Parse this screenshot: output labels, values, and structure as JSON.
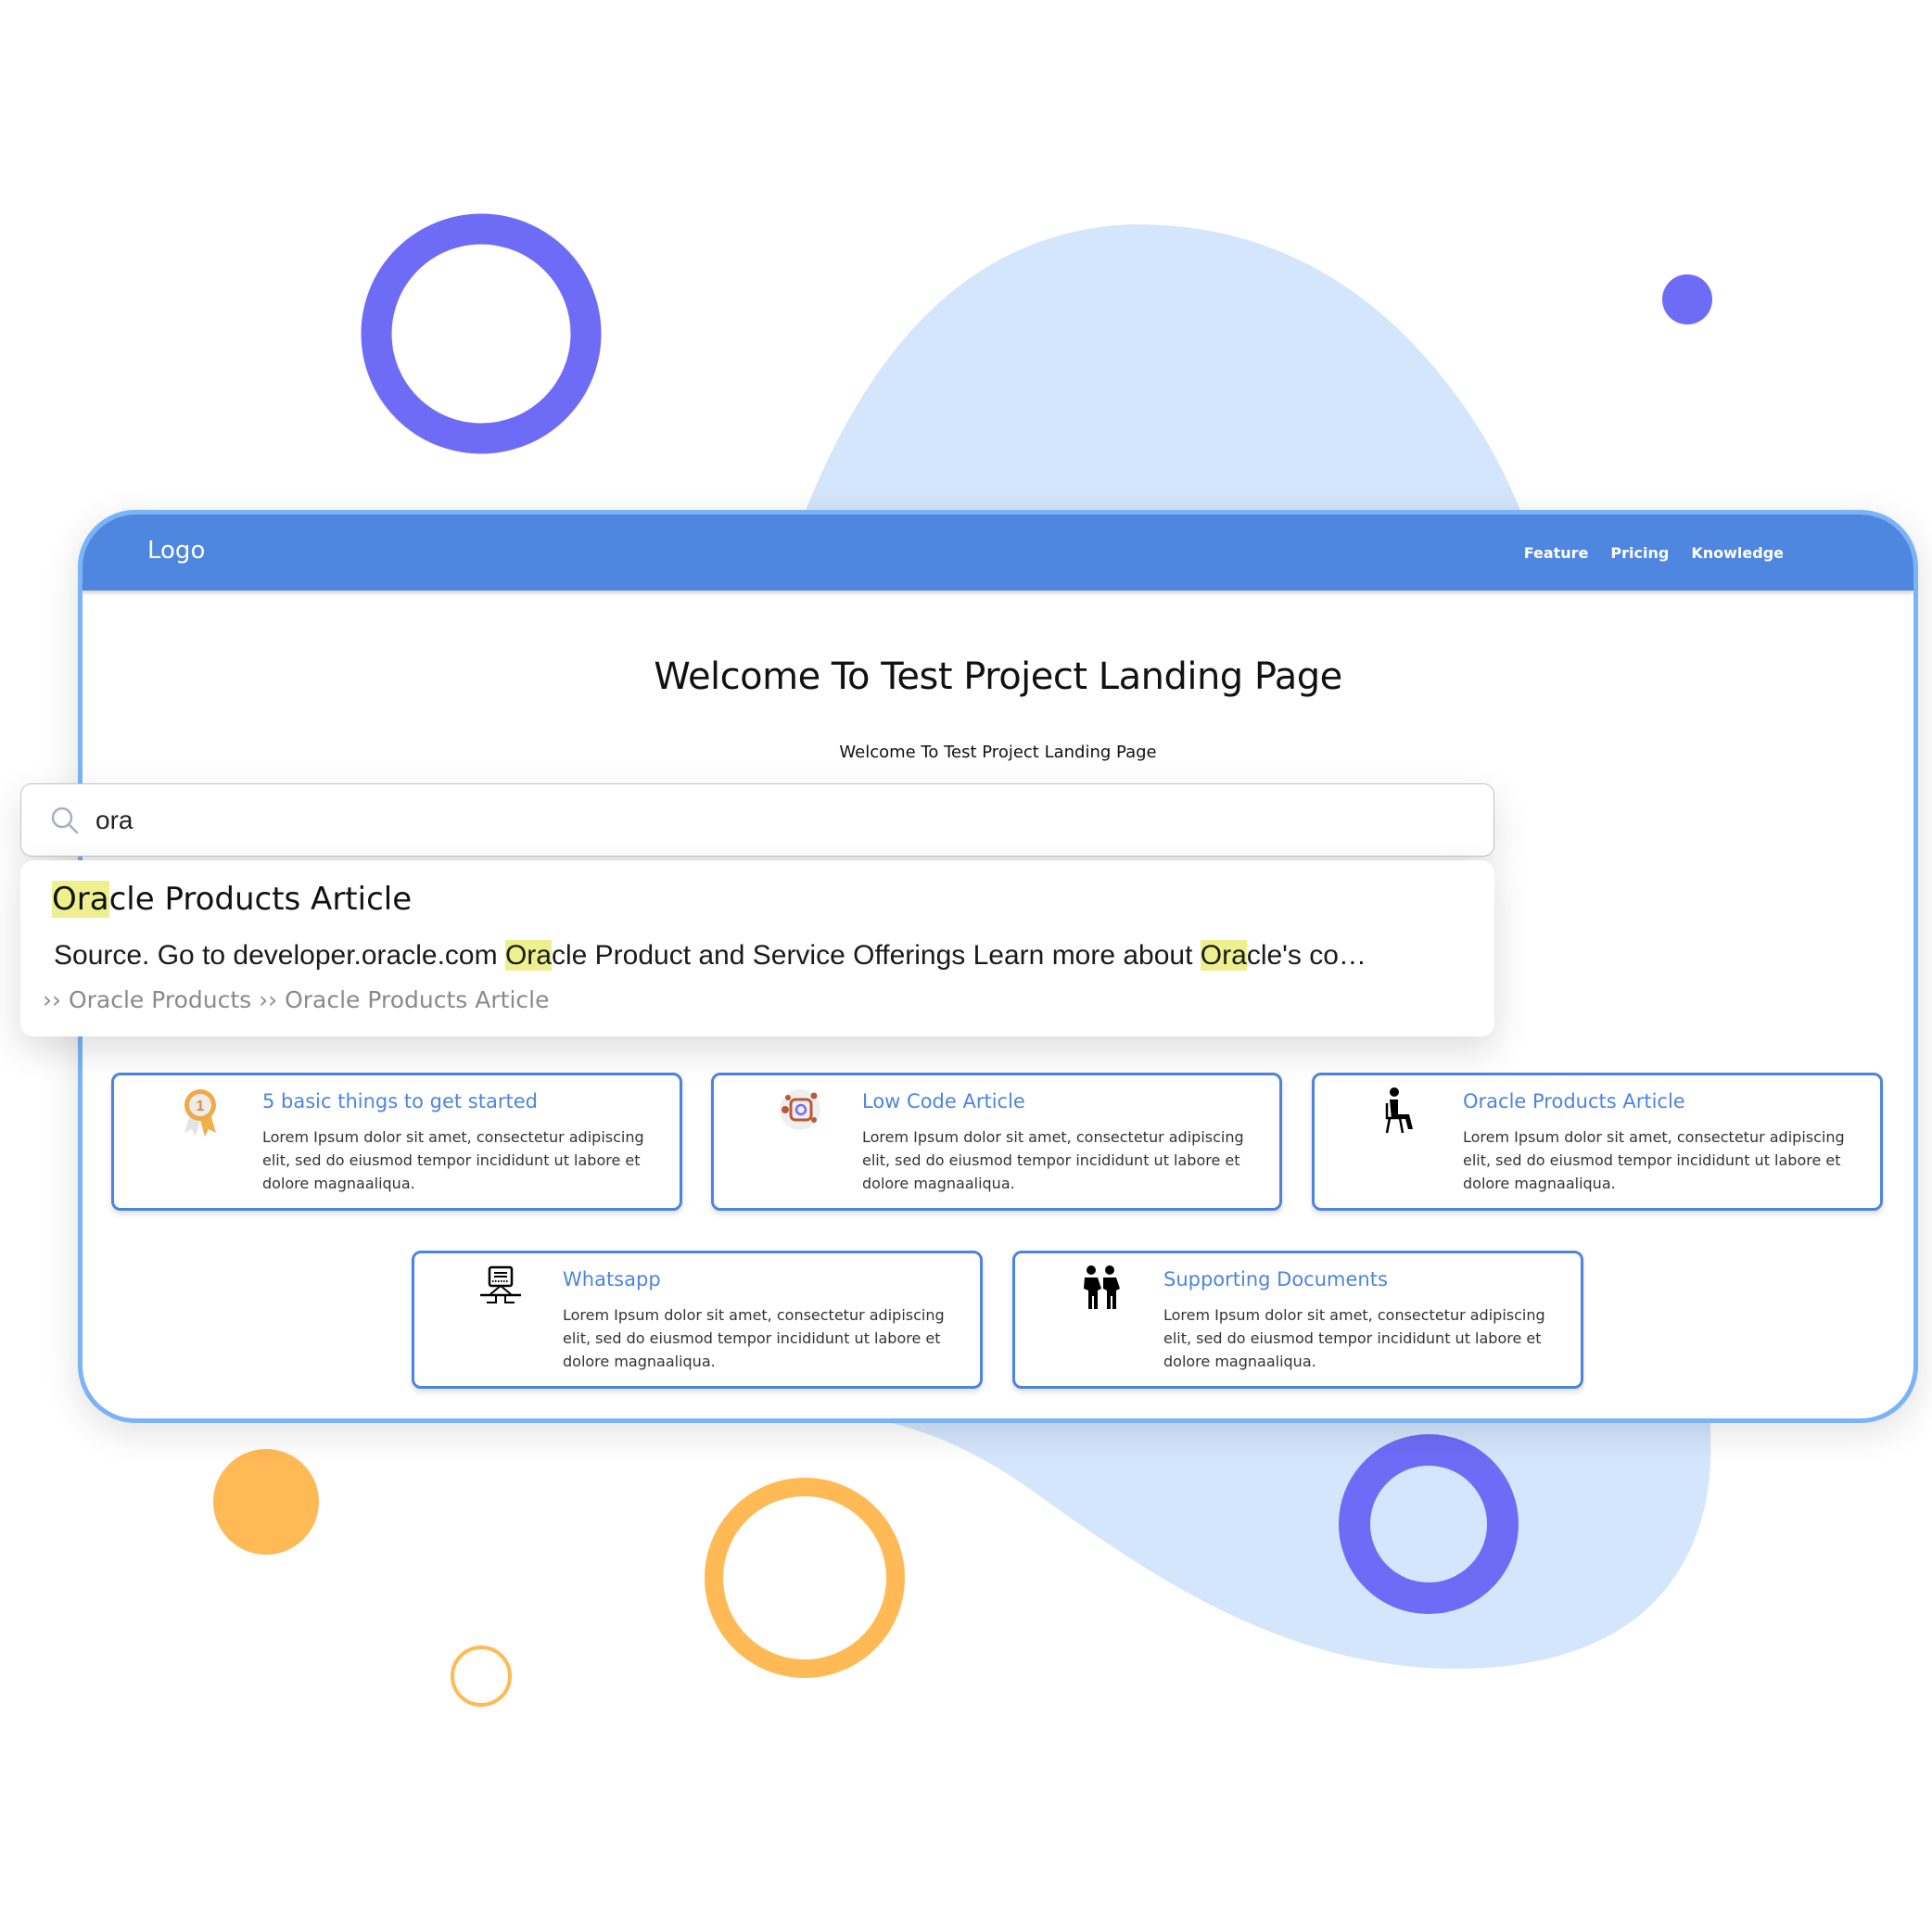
{
  "header": {
    "logo": "Logo",
    "nav": [
      "Feature",
      "Pricing",
      "Knowledge"
    ]
  },
  "hero": {
    "title": "Welcome To Test Project Landing Page",
    "subtitle": "Welcome To Test Project Landing Page"
  },
  "search": {
    "icon": "search-icon",
    "value": "ora",
    "placeholder": ""
  },
  "search_result": {
    "title_highlight": "Ora",
    "title_rest": "cle Products Article",
    "snippet_parts": [
      {
        "text": "Source. Go to developer.oracle.com ",
        "highlight": false
      },
      {
        "text": "Ora",
        "highlight": true
      },
      {
        "text": "cle Product and Service Offerings Learn more about ",
        "highlight": false
      },
      {
        "text": "Ora",
        "highlight": true
      },
      {
        "text": "cle's co…",
        "highlight": false
      }
    ],
    "path": "›› Oracle Products ›› Oracle Products Article"
  },
  "cards": [
    {
      "icon": "award-medal-icon",
      "title": "5 basic things to get started",
      "desc": "Lorem Ipsum dolor sit amet, consectetur adipiscing elit, sed do eiusmod tempor incididunt ut labore et dolore magnaaliqua."
    },
    {
      "icon": "social-media-icon",
      "title": "Low Code Article",
      "desc": "Lorem Ipsum dolor sit amet, consectetur adipiscing elit, sed do eiusmod tempor incididunt ut labore et dolore magnaaliqua."
    },
    {
      "icon": "seated-person-icon",
      "title": "Oracle Products Article",
      "desc": "Lorem Ipsum dolor sit amet, consectetur adipiscing elit, sed do eiusmod tempor incididunt ut labore et dolore magnaaliqua."
    },
    {
      "icon": "network-server-icon",
      "title": "Whatsapp",
      "desc": "Lorem Ipsum dolor sit amet, consectetur adipiscing elit, sed do eiusmod tempor incididunt ut labore et dolore magnaaliqua."
    },
    {
      "icon": "two-people-icon",
      "title": "Supporting Documents",
      "desc": "Lorem Ipsum dolor sit amet, consectetur adipiscing elit, sed do eiusmod tempor incididunt ut labore et dolore magnaaliqua."
    }
  ],
  "colors": {
    "brand_blue": "#4f86e0",
    "frame_border": "#7ab3f7",
    "card_accent": "#4d84df",
    "highlight": "#eef08f",
    "decor_purple": "#6e6cf7",
    "decor_orange": "#ffb955",
    "decor_blob": "#d4e6fc"
  }
}
